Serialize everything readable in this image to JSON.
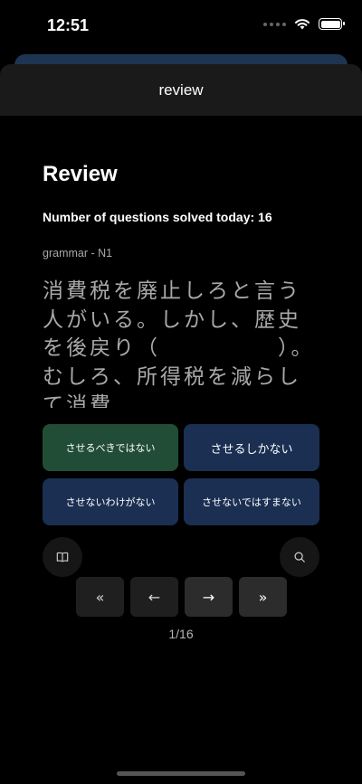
{
  "status_bar": {
    "time": "12:51"
  },
  "sheet": {
    "title": "review"
  },
  "review": {
    "title": "Review",
    "solved_label": "Number of questions solved today: 16",
    "category": "grammar - N1",
    "question": "消費税を廃止しろと言う人がいる。しかし、歴史を後戻り（　　　　　）。むしろ、所得税を減らして消費"
  },
  "answers": [
    {
      "label": "させるべきではない",
      "selected": true
    },
    {
      "label": "させるしかない",
      "selected": false
    },
    {
      "label": "させないわけがない",
      "selected": false
    },
    {
      "label": "させないではすまない",
      "selected": false
    }
  ],
  "tools": {
    "left_icon": "book-icon",
    "right_icon": "search-icon"
  },
  "nav": {
    "first": "«",
    "prev": "←",
    "next": "→",
    "last": "»"
  },
  "pagination": {
    "indicator": "1/16"
  },
  "colors": {
    "answer_default": "#1a2f52",
    "answer_selected": "#214d36",
    "header_bg": "#1a1a1a"
  }
}
